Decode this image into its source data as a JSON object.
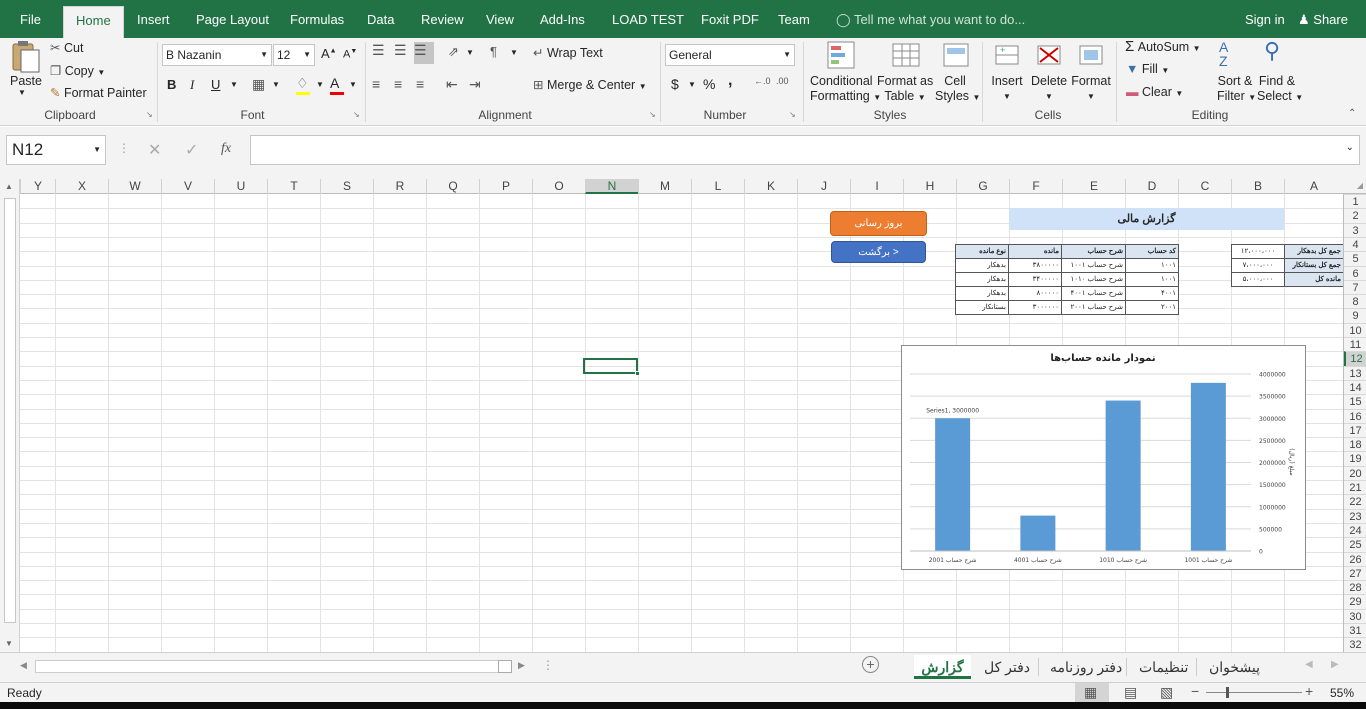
{
  "menu": {
    "file": "File",
    "tabs": [
      "Home",
      "Insert",
      "Page Layout",
      "Formulas",
      "Data",
      "Review",
      "View",
      "Add-Ins",
      "LOAD TEST",
      "Foxit PDF",
      "Team"
    ],
    "tellme": "Tell me what you want to do...",
    "signin": "Sign in",
    "share": "Share"
  },
  "ribbon": {
    "clipboard": {
      "paste": "Paste",
      "cut": "Cut",
      "copy": "Copy",
      "format_painter": "Format Painter",
      "label": "Clipboard"
    },
    "font": {
      "name": "B Nazanin",
      "size": "12",
      "bold": "B",
      "italic": "I",
      "underline": "U",
      "label": "Font"
    },
    "alignment": {
      "wrap": "Wrap Text",
      "merge": "Merge & Center",
      "label": "Alignment"
    },
    "number": {
      "format": "General",
      "currency": "$",
      "percent": "%",
      "comma": ",",
      "label": "Number"
    },
    "styles": {
      "conditional": "Conditional",
      "conditional2": "Formatting",
      "format_table": "Format as",
      "format_table2": "Table",
      "cell_styles": "Cell",
      "cell_styles2": "Styles",
      "label": "Styles"
    },
    "cells": {
      "insert": "Insert",
      "delete": "Delete",
      "format": "Format",
      "label": "Cells"
    },
    "editing": {
      "autosum": "AutoSum",
      "fill": "Fill",
      "clear": "Clear",
      "sort": "Sort &",
      "sort2": "Filter",
      "find": "Find &",
      "find2": "Select",
      "label": "Editing"
    }
  },
  "formula_bar": {
    "name_box": "N12",
    "formula": "",
    "fx": "fx"
  },
  "columns": [
    "Y",
    "X",
    "W",
    "V",
    "U",
    "T",
    "S",
    "R",
    "Q",
    "P",
    "O",
    "N",
    "M",
    "L",
    "K",
    "J",
    "I",
    "H",
    "G",
    "F",
    "E",
    "D",
    "C",
    "B",
    "A"
  ],
  "selected_column": "N",
  "rows": [
    "1",
    "2",
    "3",
    "4",
    "5",
    "6",
    "7",
    "8",
    "9",
    "10",
    "11",
    "12",
    "13",
    "14",
    "15",
    "16",
    "17",
    "18",
    "19",
    "20",
    "21",
    "22",
    "23",
    "24",
    "25",
    "26",
    "27",
    "28",
    "29",
    "30",
    "31",
    "32"
  ],
  "selected_row": "12",
  "sheet": {
    "title": "گزارش مالی",
    "summary_labels": [
      "جمع کل بدهکار",
      "جمع کل بستانکار",
      "مانده کل"
    ],
    "summary_values": [
      "۱۲،۰۰۰،۰۰۰",
      "۷،۰۰۰،۰۰۰",
      "۵،۰۰۰،۰۰۰"
    ],
    "table_headers": [
      "کد حساب",
      "شرح حساب",
      "مانده",
      "نوع مانده"
    ],
    "table_rows": [
      [
        "۱۰۰۱",
        "شرح حساب ۱۰۰۱",
        "۳۸۰۰۰۰۰",
        "بدهکار"
      ],
      [
        "۱۰۰۱",
        "شرح حساب ۱۰۱۰",
        "۳۴۰۰۰۰۰",
        "بدهکار"
      ],
      [
        "۴۰۰۱",
        "شرح حساب ۴۰۰۱",
        "۸۰۰۰۰۰",
        "بدهکار"
      ],
      [
        "۲۰۰۱",
        "شرح حساب ۲۰۰۱",
        "۳۰۰۰۰۰۰",
        "بستانکار"
      ]
    ],
    "btn_update": "بروز رسانی",
    "btn_back": "برگشت >"
  },
  "chart_data": {
    "type": "bar",
    "title": "نمودار مانده حساب‌ها",
    "categories": [
      "شرح حساب 1001",
      "شرح حساب 1010",
      "شرح حساب 4001",
      "شرح حساب 2001"
    ],
    "series": [
      {
        "name": "Series1",
        "values": [
          3800000,
          3400000,
          800000,
          3000000
        ]
      }
    ],
    "ylabel": "مبلغ (ریال)",
    "ylim": [
      0,
      4000000
    ],
    "yticks": [
      "0",
      "500000",
      "1000000",
      "1500000",
      "2000000",
      "2500000",
      "3000000",
      "3500000",
      "4000000"
    ],
    "data_label": "Series1, 3000000",
    "grid": true,
    "bar_color": "#5b9bd5"
  },
  "sheet_tabs": [
    "گزارش",
    "دفتر کل",
    "دفتر روزنامه",
    "تنظیمات",
    "پیشخوان"
  ],
  "active_sheet_tab": "گزارش",
  "status": {
    "ready": "Ready",
    "zoom": "55%"
  }
}
